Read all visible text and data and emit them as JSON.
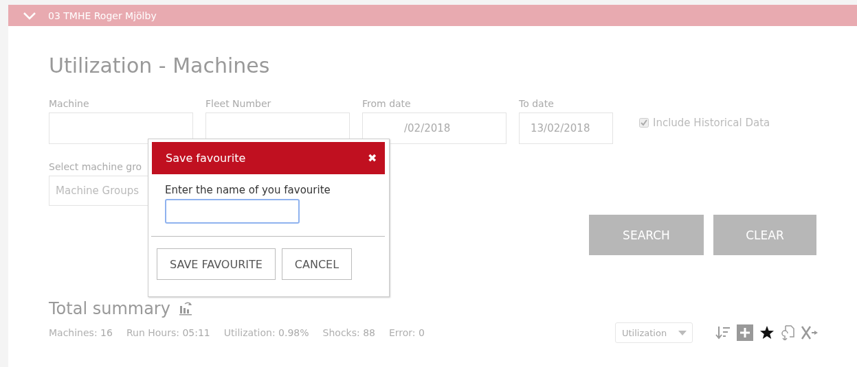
{
  "header": {
    "title": "03 TMHE Roger Mjölby",
    "expanded": true
  },
  "page_title": "Utilization - Machines",
  "filters": [
    {
      "label": "Machine"
    },
    {
      "label": "Fleet Number"
    },
    {
      "label": "From date",
      "value": "/02/2018"
    },
    {
      "label": "To date",
      "value": "13/02/2018"
    }
  ],
  "include_historical": {
    "label": "Include Historical Data",
    "checked": true,
    "disabled": true
  },
  "group_filter": {
    "label": "Select machine gro",
    "placeholder": "Machine Groups"
  },
  "buttons": [
    "SEARCH",
    "CLEAR"
  ],
  "summary": {
    "title": "Total summary",
    "stats": [
      {
        "label": "Machines:",
        "value": "16"
      },
      {
        "label": "Run Hours:",
        "value": "05:11"
      },
      {
        "label": "Utilization:",
        "value": "0.98%"
      },
      {
        "label": "Shocks:",
        "value": "88"
      },
      {
        "label": "Error:",
        "value": "0"
      }
    ],
    "view_select": "Utilization"
  },
  "dialog": {
    "title": "Save favourite",
    "close": "✖",
    "prompt": "Enter the name of you favourite",
    "buttons": [
      "SAVE FAVOURITE",
      "CANCEL"
    ]
  }
}
